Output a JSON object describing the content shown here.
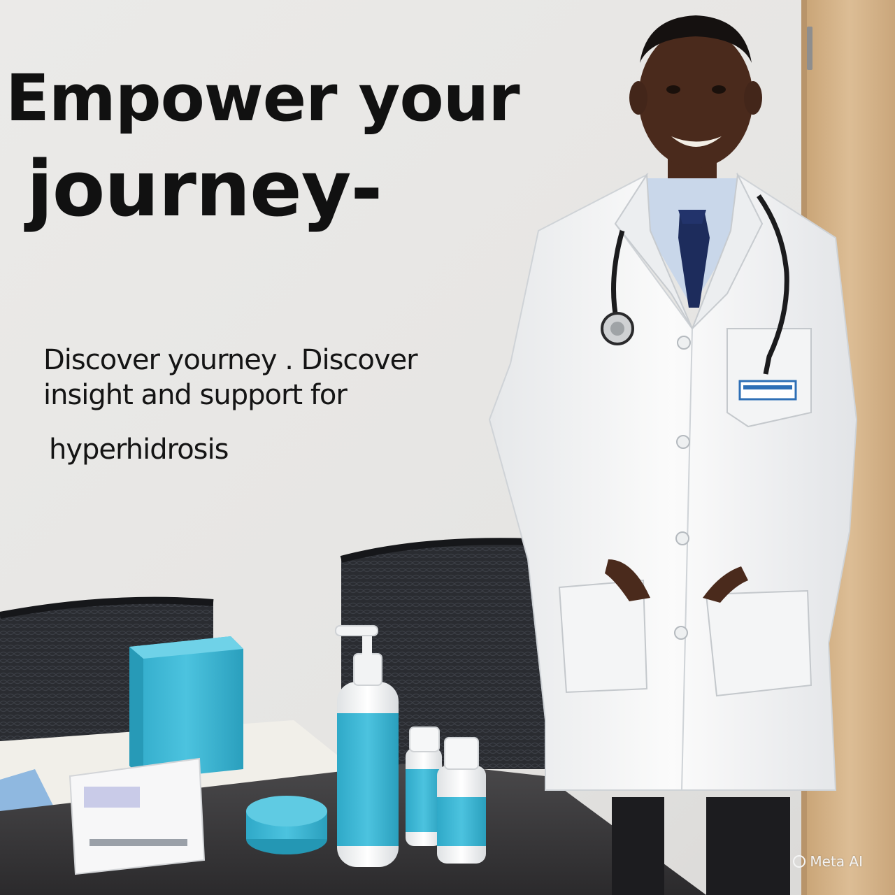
{
  "headline": {
    "line1": "Empower your",
    "line2": "journey-"
  },
  "subtext": {
    "line1": "Discover yourney . Discover",
    "line2": "insight and support for",
    "line3": "hyperhidrosis"
  },
  "watermark": "Meta AI",
  "colors": {
    "wall": "#e9e8e6",
    "door": "#d8b88e",
    "coat": "#f4f4f4",
    "tie": "#1d2c5c",
    "product_turquoise": "#3db7d4",
    "table": "#3b3a3c",
    "chair": "#222428"
  }
}
